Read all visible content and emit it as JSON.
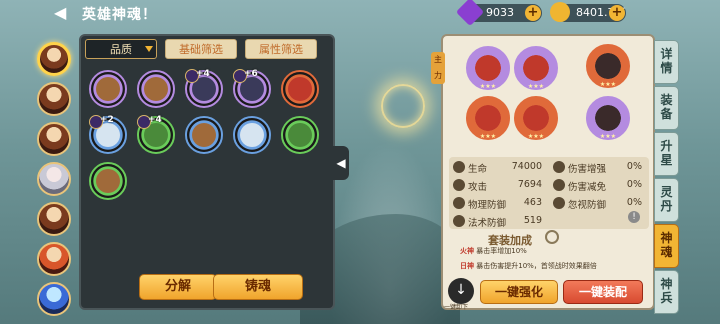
{
  "header": {
    "title": "英雄神魂！",
    "back_icon": "back-arrow-icon"
  },
  "resources": [
    {
      "icon": "purple-gem-icon",
      "value": "9033",
      "color": "#8a3fd1"
    },
    {
      "icon": "gold-coin-icon",
      "value": "8401.7万",
      "color": "#f0b530"
    }
  ],
  "heroes": [
    "hero-1",
    "hero-2",
    "hero-3",
    "hero-4",
    "hero-5",
    "hero-6",
    "hero-7"
  ],
  "filter": {
    "quality": "品质",
    "set_filter": "基础筛选",
    "attr_filter": "属性筛选"
  },
  "soul_items": [
    {
      "icon": "griffin-icon",
      "frame": "#b48be0",
      "level": ""
    },
    {
      "icon": "griffin-icon",
      "frame": "#b48be0",
      "level": ""
    },
    {
      "icon": "dark-wolf-icon",
      "frame": "#b48be0",
      "level": "+4"
    },
    {
      "icon": "dark-wolf-icon",
      "frame": "#b48be0",
      "level": "+6"
    },
    {
      "icon": "phoenix-icon",
      "frame": "#e06a3a",
      "level": ""
    },
    {
      "icon": "white-tiger-icon",
      "frame": "#6aa0e0",
      "level": "+2"
    },
    {
      "icon": "green-serpent-icon",
      "frame": "#6acc5a",
      "level": "+4"
    },
    {
      "icon": "griffin-icon",
      "frame": "#6aa0e0",
      "level": ""
    },
    {
      "icon": "white-tiger-icon",
      "frame": "#6aa0e0",
      "level": ""
    },
    {
      "icon": "green-serpent-icon",
      "frame": "#6acc5a",
      "level": ""
    },
    {
      "icon": "griffin-icon",
      "frame": "#6acc5a",
      "level": ""
    }
  ],
  "left_buttons": {
    "decompose": "分解",
    "forge": "铸魂"
  },
  "main_tag": "主力",
  "equipped": [
    {
      "icon": "phoenix-icon",
      "frame": "#b48be0"
    },
    {
      "icon": "phoenix-icon",
      "frame": "#b48be0"
    },
    {
      "icon": "dark-bird-icon",
      "frame": "#e06a3a"
    },
    {
      "icon": "phoenix-icon",
      "frame": "#e06a3a"
    },
    {
      "icon": "phoenix-icon",
      "frame": "#e06a3a"
    },
    {
      "icon": "dark-bird-icon",
      "frame": "#b48be0"
    }
  ],
  "stats": [
    {
      "label": "生命",
      "value": "74000"
    },
    {
      "label": "攻击",
      "value": "7694"
    },
    {
      "label": "物理防御",
      "value": "463"
    },
    {
      "label": "法术防御",
      "value": "519"
    }
  ],
  "stats_pct": [
    {
      "label": "伤害增强",
      "value": "0%"
    },
    {
      "label": "伤害减免",
      "value": "0%"
    },
    {
      "label": "忽视防御",
      "value": "0%"
    }
  ],
  "set_bonus": {
    "title": "套装加成",
    "lines": [
      {
        "name": "火神",
        "text": "暴击率增加10%"
      },
      {
        "name": "日神",
        "text": "暴击伤害提升10%，首领战时效果翻倍"
      }
    ]
  },
  "bottom": {
    "one_click_unequip": "一键卸下",
    "strengthen": "一键强化",
    "equip": "一键装配"
  },
  "side_tabs": [
    {
      "label": "详情",
      "active": false
    },
    {
      "label": "装备",
      "active": false
    },
    {
      "label": "升星",
      "active": false
    },
    {
      "label": "灵丹",
      "active": false
    },
    {
      "label": "神魂",
      "active": true
    },
    {
      "label": "神兵",
      "active": false
    }
  ]
}
